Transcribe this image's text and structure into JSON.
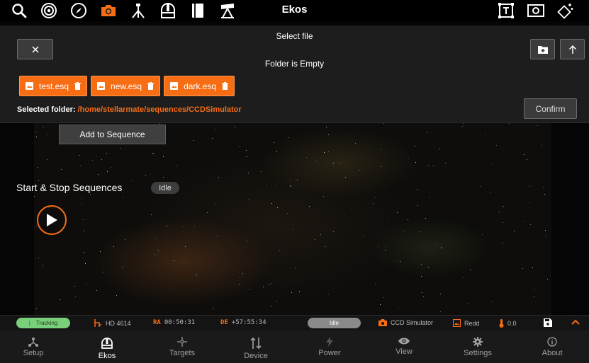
{
  "topbar": {
    "title": "Ekos",
    "icons": [
      "search-icon",
      "target-icon",
      "compass-icon",
      "camera-icon",
      "tripod-icon",
      "observatory-icon",
      "notebook-icon",
      "telescope-icon",
      "text-frame-icon",
      "image-frame-icon",
      "wand-icon"
    ]
  },
  "dialog": {
    "title": "Select file",
    "empty_message": "Folder is Empty",
    "files": [
      {
        "name": "test.esq"
      },
      {
        "name": "new.esq"
      },
      {
        "name": "dark.esq"
      }
    ],
    "selected_folder_label": "Selected folder:",
    "selected_folder_path": "/home/stellarmate/sequences/CCDSimulator",
    "confirm_label": "Confirm"
  },
  "main": {
    "add_to_sequence_label": "Add to Sequence",
    "start_stop_label": "Start & Stop Sequences",
    "status": "Idle"
  },
  "statusbar": {
    "tracking": "Tracking",
    "target": "HD 4614",
    "ra_label": "RA",
    "ra_value": "00:50:31",
    "de_label": "DE",
    "de_value": "+57:55:34",
    "state": "Idle",
    "camera": "CCD Simulator",
    "filter": "Redd",
    "temperature": "0.0",
    "colors": {
      "accent": "#f76d14",
      "tracking": "#7ad07a"
    }
  },
  "nav": {
    "items": [
      {
        "label": "Setup"
      },
      {
        "label": "Ekos"
      },
      {
        "label": "Targets"
      },
      {
        "label": "Device"
      },
      {
        "label": "Power"
      },
      {
        "label": "View"
      },
      {
        "label": "Settings"
      },
      {
        "label": "About"
      }
    ],
    "active": "Ekos"
  }
}
